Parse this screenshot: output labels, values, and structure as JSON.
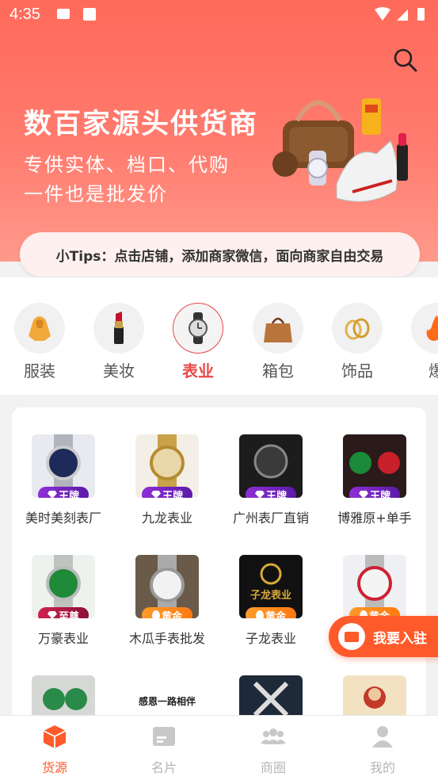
{
  "status_bar": {
    "time": "4:35"
  },
  "hero": {
    "title": "数百家源头供货商",
    "subtitle_line1": "专供实体、档口、代购",
    "subtitle_line2": "一件也是批发价"
  },
  "tips": {
    "text": "小Tips：点击店铺，添加商家微信，面向商家自由交易"
  },
  "categories": [
    {
      "label": "服装",
      "icon": "hoodie-icon",
      "active": false
    },
    {
      "label": "美妆",
      "icon": "lipstick-icon",
      "active": false
    },
    {
      "label": "表业",
      "icon": "watch-icon",
      "active": true
    },
    {
      "label": "箱包",
      "icon": "handbag-icon",
      "active": false
    },
    {
      "label": "饰品",
      "icon": "rings-icon",
      "active": false
    },
    {
      "label": "爆",
      "icon": "hot-flame-icon",
      "active": false
    }
  ],
  "stores": [
    {
      "name": "美时美刻表厂",
      "badge": "王牌",
      "tier": "wang"
    },
    {
      "name": "九龙表业",
      "badge": "王牌",
      "tier": "wang"
    },
    {
      "name": "广州表厂直销",
      "badge": "王牌",
      "tier": "wang"
    },
    {
      "name": "博雅原+单手",
      "badge": "王牌",
      "tier": "wang"
    },
    {
      "name": "万豪表业",
      "badge": "至尊",
      "tier": "zun"
    },
    {
      "name": "木瓜手表批发",
      "badge": "黄金",
      "tier": "jin"
    },
    {
      "name": "子龙表业",
      "badge": "黄金",
      "tier": "jin"
    },
    {
      "name": "",
      "badge": "黄金",
      "tier": "jin"
    }
  ],
  "store_thumb_texts": {
    "zilong": "子龙表业",
    "calligraphy": "感恩一路相伴"
  },
  "join_button": {
    "label": "我要入驻"
  },
  "tabs": [
    {
      "label": "货源",
      "icon": "cube-icon",
      "active": true
    },
    {
      "label": "名片",
      "icon": "card-icon",
      "active": false
    },
    {
      "label": "商圈",
      "icon": "group-icon",
      "active": false
    },
    {
      "label": "我的",
      "icon": "person-icon",
      "active": false
    }
  ],
  "colors": {
    "accent": "#ff5a2a",
    "active_category": "#e94848",
    "hero": "#ff6a5a"
  }
}
